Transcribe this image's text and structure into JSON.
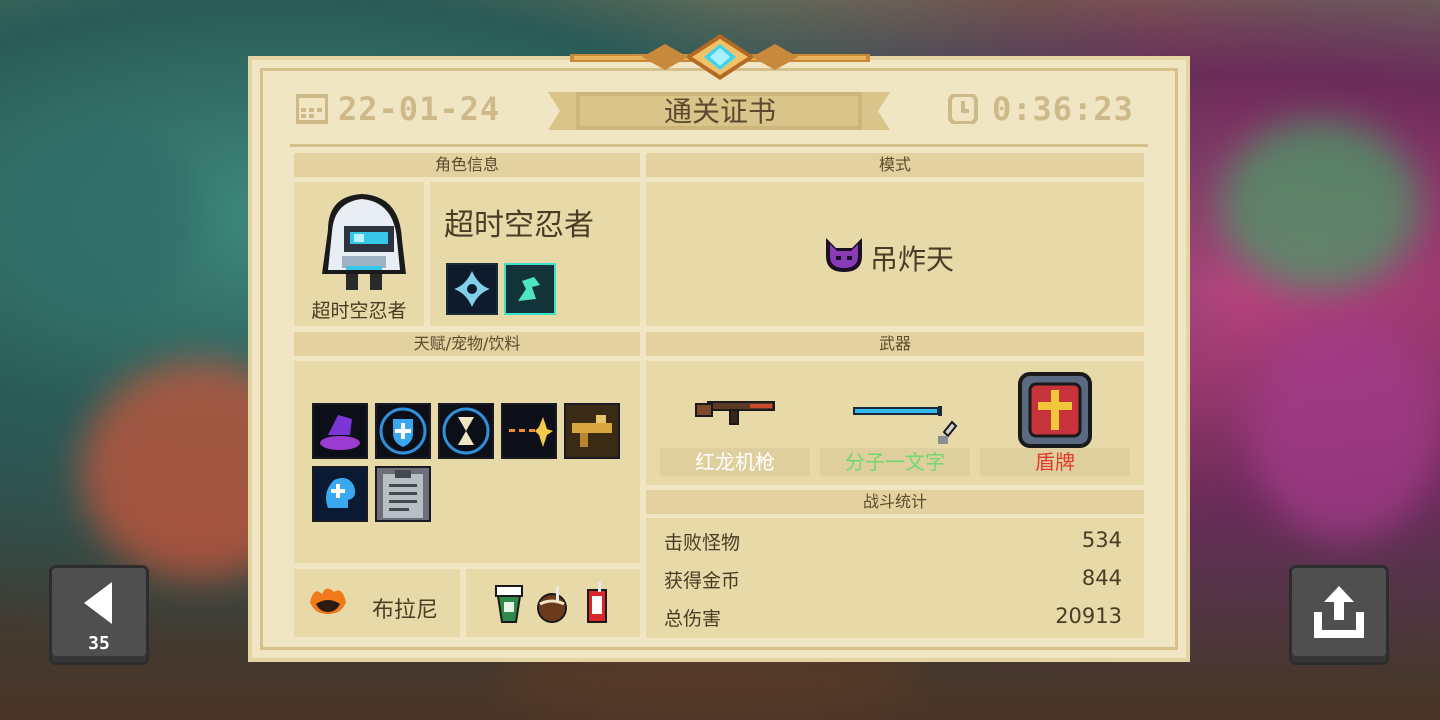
{
  "certificate": {
    "date": "22-01-24",
    "title": "通关证书",
    "time": "0:36:23"
  },
  "sections": {
    "character_info": "角色信息",
    "mode": "模式",
    "talents_pets_drinks": "天赋/宠物/饮料",
    "weapons": "武器",
    "battle_stats": "战斗统计"
  },
  "character": {
    "name": "超时空忍者",
    "portrait_caption": "超时空忍者",
    "skills": [
      "shuriken-skill-icon",
      "ninja-dash-skill-icon"
    ]
  },
  "mode": {
    "name": "吊炸天",
    "icon": "horned-demon-icon"
  },
  "talents": [
    "purple-hand-talent-icon",
    "shield-talent-icon",
    "hourglass-talent-icon",
    "spark-bullet-talent-icon",
    "golden-gun-talent-icon",
    "brain-talent-icon",
    "clipboard-talent-icon"
  ],
  "pet": {
    "name": "布拉尼",
    "icon": "flame-pet-icon"
  },
  "drinks": [
    "green-cup-drink-icon",
    "coconut-drink-icon",
    "red-can-drink-icon"
  ],
  "weapons": [
    {
      "name": "红龙机枪",
      "color": "#ffffff",
      "icon": "machine-gun-icon"
    },
    {
      "name": "分子一文字",
      "color": "#6fd86f",
      "icon": "laser-katana-icon"
    },
    {
      "name": "盾牌",
      "color": "#e23c2c",
      "icon": "shield-icon"
    }
  ],
  "stats": [
    {
      "label": "击败怪物",
      "value": "534"
    },
    {
      "label": "获得金币",
      "value": "844"
    },
    {
      "label": "总伤害",
      "value": "20913"
    }
  ],
  "controls": {
    "back_countdown": "35"
  }
}
